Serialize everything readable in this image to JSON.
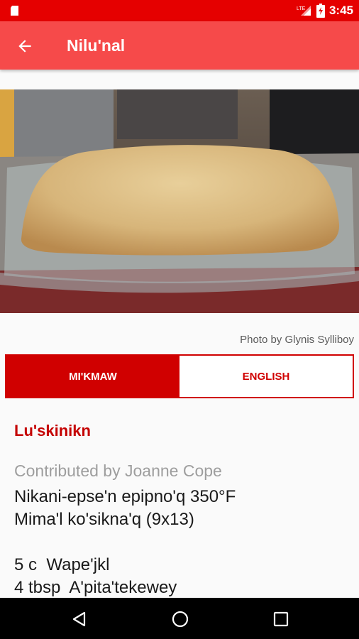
{
  "status_bar": {
    "time": "3:45",
    "icons": [
      "sd-card-icon",
      "lte-signal-icon",
      "battery-charging-icon"
    ]
  },
  "app_bar": {
    "title": "Nilu'nal",
    "back_icon": "arrow-left-icon"
  },
  "photo": {
    "subject": "baked bread in glass baking dish",
    "credit": "Photo by Glynis Sylliboy"
  },
  "tabs": [
    {
      "label": "MI'KMAW",
      "active": true
    },
    {
      "label": "ENGLISH",
      "active": false
    }
  ],
  "recipe": {
    "title": "Lu'skinikn",
    "contributor": "Contributed by Joanne Cope",
    "lines": [
      "Nikani-epse'n epipno'q 350°F",
      "Mima'l ko'sikna'q (9x13)",
      "",
      "5 c  Wape'jkl",
      "4 tbsp  A'pita'tekewey"
    ]
  },
  "nav_bar": {
    "buttons": [
      "back-triangle-icon",
      "home-circle-icon",
      "recents-square-icon"
    ]
  },
  "colors": {
    "status_bar": "#e50000",
    "app_bar": "#f64a4a",
    "accent": "#d00000",
    "title_red": "#c40000"
  }
}
